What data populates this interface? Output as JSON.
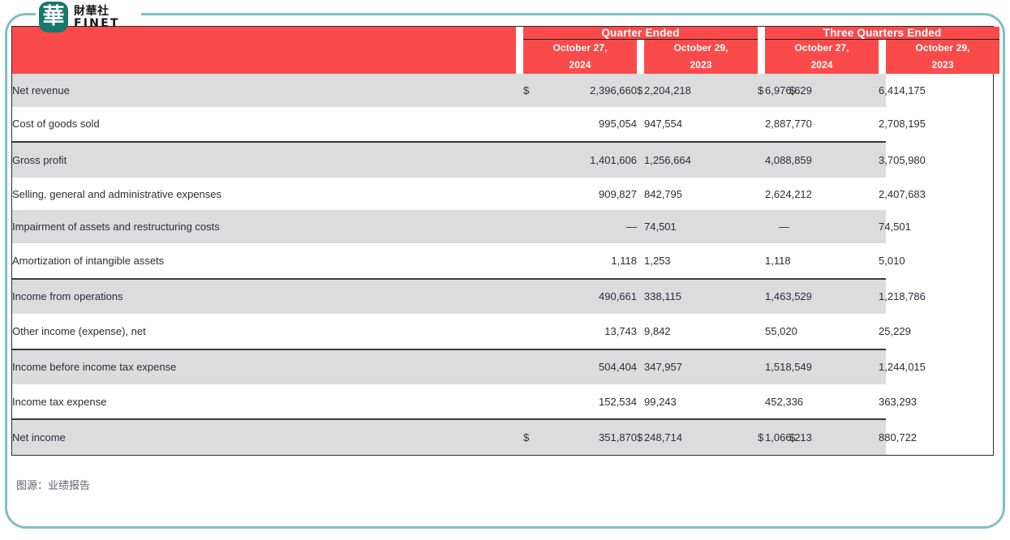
{
  "brand": {
    "mark_glyph": "華",
    "name_cn": "財華社",
    "name_en": "FINET"
  },
  "watermark": {
    "mark_glyph": "華",
    "text_cn": "財華社",
    "text_en": "FINET"
  },
  "colors": {
    "header_red": "#fb4a4a",
    "frame_teal": "#7fc0c0",
    "logo_teal": "#17776b",
    "row_shade": "#dcdcdc",
    "text": "#2c2c3a"
  },
  "table": {
    "group_headers": [
      {
        "label": "",
        "span": 1
      },
      {
        "label": "Quarter Ended",
        "span": 1
      },
      {
        "label": "Three Quarters Ended",
        "span": 1
      }
    ],
    "group_quarter": "Quarter Ended",
    "group_three_quarters": "Three Quarters Ended",
    "columns": [
      {
        "date": "October 27,",
        "year": "2024"
      },
      {
        "date": "October 29,",
        "year": "2023"
      },
      {
        "date": "October 27,",
        "year": "2024"
      },
      {
        "date": "October 29,",
        "year": "2023"
      }
    ],
    "currency_symbol": "$",
    "dash": "—",
    "rows": [
      {
        "label": "Net revenue",
        "shaded": true,
        "topline": false,
        "currency": [
          true,
          true,
          true,
          true
        ],
        "values": [
          "2,396,660",
          "2,204,218",
          "6,976,629",
          "6,414,175"
        ]
      },
      {
        "label": "Cost of goods sold",
        "shaded": false,
        "topline": false,
        "currency": [
          false,
          false,
          false,
          false
        ],
        "values": [
          "995,054",
          "947,554",
          "2,887,770",
          "2,708,195"
        ]
      },
      {
        "label": "Gross profit",
        "shaded": true,
        "topline": true,
        "currency": [
          false,
          false,
          false,
          false
        ],
        "values": [
          "1,401,606",
          "1,256,664",
          "4,088,859",
          "3,705,980"
        ]
      },
      {
        "label": "Selling, general and administrative expenses",
        "shaded": false,
        "topline": false,
        "currency": [
          false,
          false,
          false,
          false
        ],
        "values": [
          "909,827",
          "842,795",
          "2,624,212",
          "2,407,683"
        ]
      },
      {
        "label": "Impairment of assets and restructuring costs",
        "shaded": true,
        "topline": false,
        "currency": [
          false,
          false,
          false,
          false
        ],
        "values": [
          "—",
          "74,501",
          "—",
          "74,501"
        ]
      },
      {
        "label": "Amortization of intangible assets",
        "shaded": false,
        "topline": false,
        "currency": [
          false,
          false,
          false,
          false
        ],
        "values": [
          "1,118",
          "1,253",
          "1,118",
          "5,010"
        ]
      },
      {
        "label": "Income from operations",
        "shaded": true,
        "topline": true,
        "currency": [
          false,
          false,
          false,
          false
        ],
        "values": [
          "490,661",
          "338,115",
          "1,463,529",
          "1,218,786"
        ]
      },
      {
        "label": "Other income (expense), net",
        "shaded": false,
        "topline": false,
        "currency": [
          false,
          false,
          false,
          false
        ],
        "values": [
          "13,743",
          "9,842",
          "55,020",
          "25,229"
        ]
      },
      {
        "label": "Income before income tax expense",
        "shaded": true,
        "topline": true,
        "currency": [
          false,
          false,
          false,
          false
        ],
        "values": [
          "504,404",
          "347,957",
          "1,518,549",
          "1,244,015"
        ]
      },
      {
        "label": "Income tax expense",
        "shaded": false,
        "topline": false,
        "currency": [
          false,
          false,
          false,
          false
        ],
        "values": [
          "152,534",
          "99,243",
          "452,336",
          "363,293"
        ]
      },
      {
        "label": "Net income",
        "shaded": true,
        "topline": true,
        "currency": [
          true,
          true,
          true,
          true
        ],
        "values": [
          "351,870",
          "248,714",
          "1,066,213",
          "880,722"
        ]
      }
    ]
  },
  "caption": "图源：业绩报告"
}
